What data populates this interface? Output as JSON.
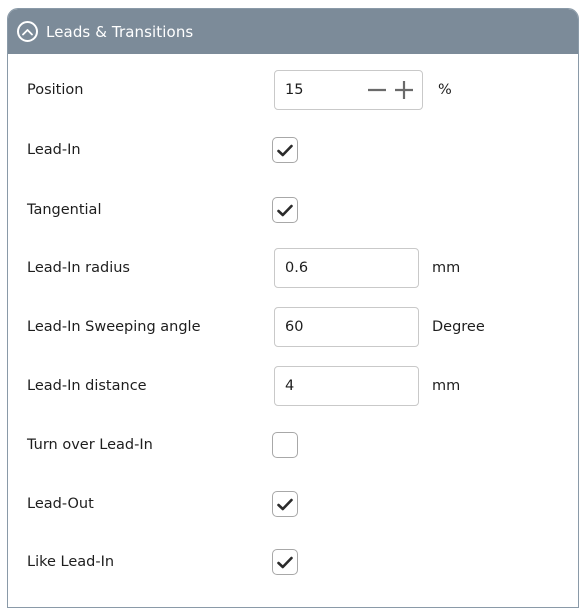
{
  "header": {
    "title": "Leads & Transitions",
    "collapse_icon": "chevron-up-circle-icon",
    "color": "#7c8b99"
  },
  "fields": {
    "position": {
      "label": "Position",
      "value": "15",
      "unit": "%"
    },
    "lead_in": {
      "label": "Lead-In",
      "checked": true
    },
    "tangential": {
      "label": "Tangential",
      "checked": true
    },
    "lead_in_radius": {
      "label": "Lead-In radius",
      "value": "0.6",
      "unit": "mm"
    },
    "lead_in_sweeping_angle": {
      "label": "Lead-In Sweeping angle",
      "value": "60",
      "unit": "Degree"
    },
    "lead_in_distance": {
      "label": "Lead-In distance",
      "value": "4",
      "unit": "mm"
    },
    "turn_over_lead_in": {
      "label": "Turn over Lead-In",
      "checked": false
    },
    "lead_out": {
      "label": "Lead-Out",
      "checked": true
    },
    "like_lead_in": {
      "label": "Like Lead-In",
      "checked": true
    }
  },
  "icons": {
    "check": "checkmark-icon",
    "minus": "minus-icon",
    "plus": "plus-icon"
  }
}
